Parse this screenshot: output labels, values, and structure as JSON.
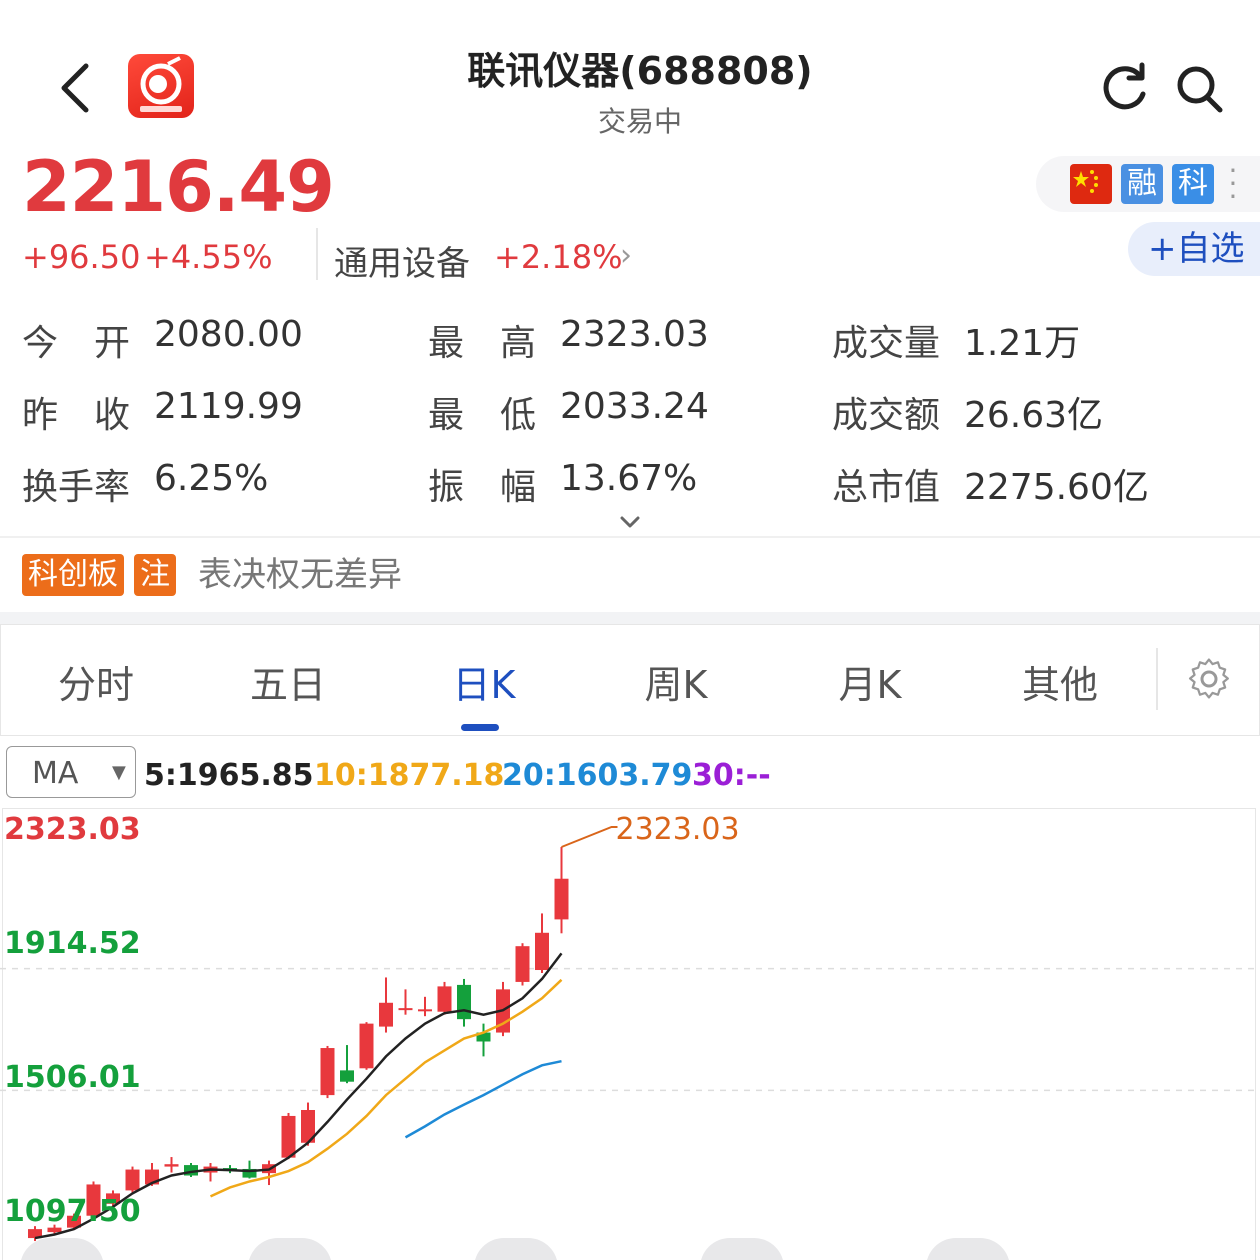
{
  "header": {
    "title": "联讯仪器(688808)",
    "status": "交易中"
  },
  "quote": {
    "price": "2216.49",
    "change_abs": "+96.50",
    "change_pct": "+4.55%",
    "sector_name": "通用设备",
    "sector_pct": "+2.18%",
    "watch_label": "+自选",
    "badges": {
      "rong": "融",
      "ke": "科"
    }
  },
  "stats": [
    {
      "label": "今　开",
      "value": "2080.00"
    },
    {
      "label": "最　高",
      "value": "2323.03"
    },
    {
      "label": "成交量",
      "value": "1.21万"
    },
    {
      "label": "昨　收",
      "value": "2119.99"
    },
    {
      "label": "最　低",
      "value": "2033.24"
    },
    {
      "label": "成交额",
      "value": "26.63亿"
    },
    {
      "label": "换手率",
      "value": "6.25%"
    },
    {
      "label": "振　幅",
      "value": "13.67%"
    },
    {
      "label": "总市值",
      "value": "2275.60亿"
    }
  ],
  "tags": {
    "board": "科创板",
    "note": "注",
    "desc": "表决权无差异"
  },
  "tabs": [
    "分时",
    "五日",
    "日K",
    "周K",
    "月K",
    "其他"
  ],
  "active_tab": "日K",
  "ma": {
    "selector": "MA",
    "ma5": "5:1965.85",
    "ma10": "10:1877.18",
    "ma20": "20:1603.79",
    "ma30": "30:--",
    "colors": {
      "ma5": "#222222",
      "ma10": "#f0a818",
      "ma20": "#1e8ad6",
      "ma30": "#9b1fd6"
    }
  },
  "chart_data": {
    "type": "candlestick",
    "y_axis_labels": [
      "2323.03",
      "1914.52",
      "1506.01",
      "1097.50"
    ],
    "max_marker": "2323.03",
    "ylim": [
      1050,
      2330
    ],
    "colors": {
      "up": "#e8383d",
      "down": "#14a03c",
      "ma5": "#222222",
      "ma10": "#f0a818",
      "ma20": "#1e8ad6"
    },
    "candles": [
      {
        "o": 1010,
        "c": 1040,
        "h": 1050,
        "l": 1000
      },
      {
        "o": 1030,
        "c": 1045,
        "h": 1055,
        "l": 1020
      },
      {
        "o": 1045,
        "c": 1085,
        "h": 1092,
        "l": 1040
      },
      {
        "o": 1085,
        "c": 1190,
        "h": 1200,
        "l": 1080
      },
      {
        "o": 1125,
        "c": 1160,
        "h": 1170,
        "l": 1110
      },
      {
        "o": 1170,
        "c": 1240,
        "h": 1250,
        "l": 1160
      },
      {
        "o": 1190,
        "c": 1240,
        "h": 1262,
        "l": 1185
      },
      {
        "o": 1250,
        "c": 1258,
        "h": 1282,
        "l": 1230
      },
      {
        "o": 1255,
        "c": 1220,
        "h": 1262,
        "l": 1215
      },
      {
        "o": 1230,
        "c": 1250,
        "h": 1262,
        "l": 1200
      },
      {
        "o": 1245,
        "c": 1235,
        "h": 1255,
        "l": 1228
      },
      {
        "o": 1242,
        "c": 1213,
        "h": 1270,
        "l": 1210
      },
      {
        "o": 1228,
        "c": 1258,
        "h": 1270,
        "l": 1188
      },
      {
        "o": 1280,
        "c": 1420,
        "h": 1430,
        "l": 1275
      },
      {
        "o": 1330,
        "c": 1440,
        "h": 1465,
        "l": 1320
      },
      {
        "o": 1490,
        "c": 1648,
        "h": 1655,
        "l": 1480
      },
      {
        "o": 1573,
        "c": 1535,
        "h": 1658,
        "l": 1530
      },
      {
        "o": 1580,
        "c": 1730,
        "h": 1735,
        "l": 1575
      },
      {
        "o": 1720,
        "c": 1800,
        "h": 1885,
        "l": 1700
      },
      {
        "o": 1780,
        "c": 1782,
        "h": 1845,
        "l": 1760
      },
      {
        "o": 1775,
        "c": 1778,
        "h": 1820,
        "l": 1755
      },
      {
        "o": 1770,
        "c": 1855,
        "h": 1870,
        "l": 1760
      },
      {
        "o": 1860,
        "c": 1745,
        "h": 1880,
        "l": 1720
      },
      {
        "o": 1700,
        "c": 1670,
        "h": 1730,
        "l": 1620
      },
      {
        "o": 1700,
        "c": 1845,
        "h": 1870,
        "l": 1688
      },
      {
        "o": 1870,
        "c": 1990,
        "h": 2000,
        "l": 1858
      },
      {
        "o": 1910,
        "c": 2035,
        "h": 2100,
        "l": 1900
      },
      {
        "o": 2080,
        "c": 2216.49,
        "h": 2323.03,
        "l": 2033.24
      }
    ],
    "ma5_series": [
      1010,
      1022,
      1040,
      1075,
      1115,
      1160,
      1195,
      1220,
      1232,
      1240,
      1238,
      1235,
      1240,
      1280,
      1330,
      1400,
      1475,
      1545,
      1620,
      1680,
      1730,
      1765,
      1775,
      1760,
      1775,
      1815,
      1880,
      1965.85
    ],
    "ma10_series": [
      null,
      null,
      null,
      null,
      null,
      null,
      null,
      null,
      null,
      1150,
      1180,
      1200,
      1215,
      1235,
      1265,
      1310,
      1360,
      1420,
      1490,
      1545,
      1600,
      1640,
      1680,
      1700,
      1730,
      1770,
      1815,
      1877.18
    ],
    "ma20_series": [
      null,
      null,
      null,
      null,
      null,
      null,
      null,
      null,
      null,
      null,
      null,
      null,
      null,
      null,
      null,
      null,
      null,
      null,
      null,
      1348,
      1385,
      1425,
      1458,
      1490,
      1525,
      1560,
      1590,
      1603.79
    ]
  }
}
